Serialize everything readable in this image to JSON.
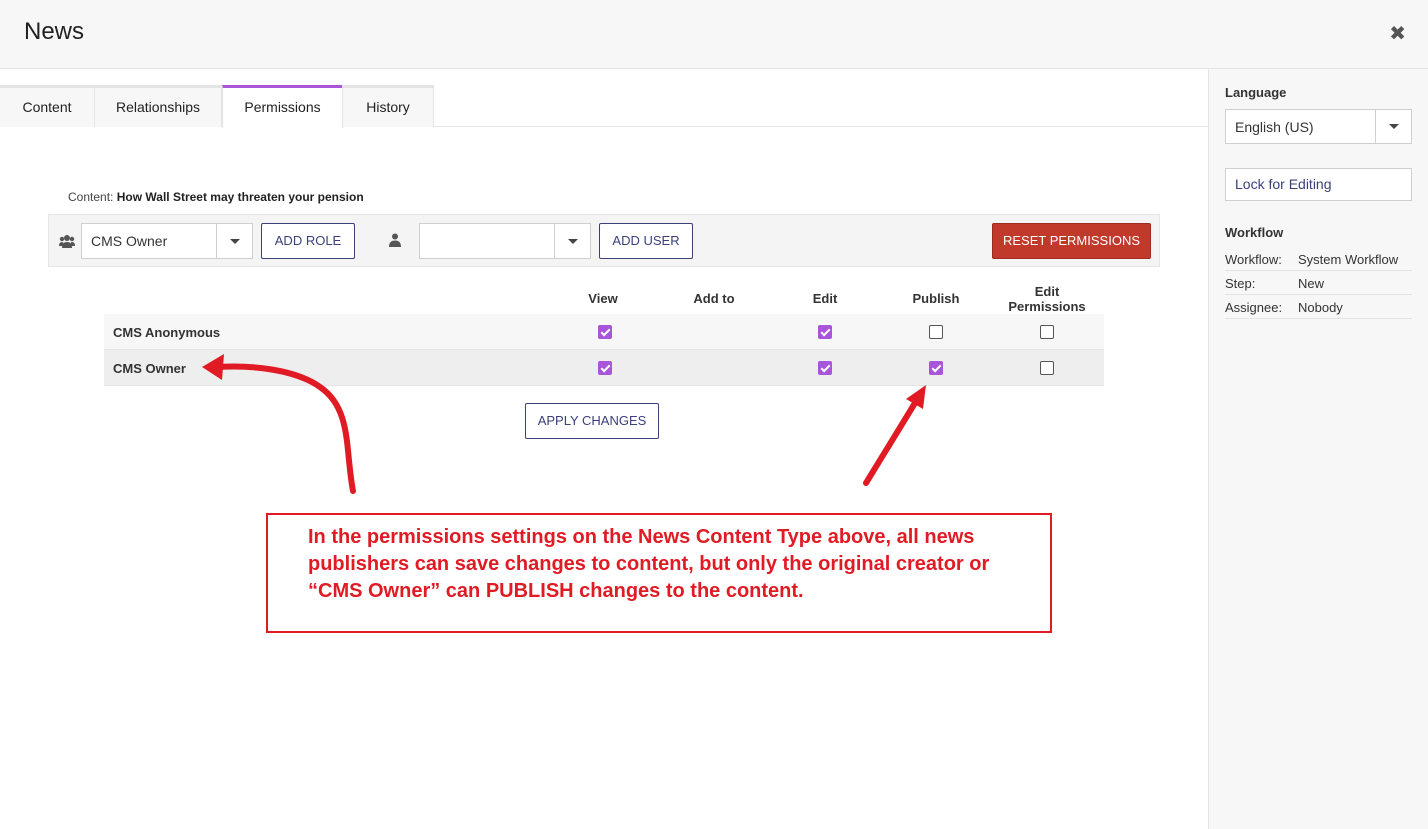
{
  "header": {
    "title": "News"
  },
  "tabs": [
    {
      "label": "Content",
      "active": false
    },
    {
      "label": "Relationships",
      "active": false
    },
    {
      "label": "Permissions",
      "active": true
    },
    {
      "label": "History",
      "active": false
    }
  ],
  "content": {
    "prefix": "Content:",
    "title": "How Wall Street may threaten your pension"
  },
  "toolbar": {
    "role_select_value": "CMS Owner",
    "add_role_label": "ADD ROLE",
    "user_select_value": "",
    "add_user_label": "ADD USER",
    "reset_label": "RESET PERMISSIONS"
  },
  "permissions": {
    "columns": [
      "View",
      "Add to",
      "Edit",
      "Publish",
      "Edit Permissions"
    ],
    "rows": [
      {
        "role": "CMS Anonymous",
        "view": true,
        "edit": true,
        "publish": false,
        "edit_permissions": false
      },
      {
        "role": "CMS Owner",
        "view": true,
        "edit": true,
        "publish": true,
        "edit_permissions": false
      }
    ]
  },
  "apply_label": "APPLY CHANGES",
  "callout": {
    "text": "In the permissions settings on the News Content Type above, all news publishers can save changes to content, but only the original creator or “CMS Owner” can PUBLISH changes to the content."
  },
  "sidebar": {
    "language_label": "Language",
    "language_value": "English (US)",
    "lock_label": "Lock for Editing",
    "workflow_label": "Workflow",
    "workflow": [
      {
        "key": "Workflow:",
        "value": "System Workflow"
      },
      {
        "key": "Step:",
        "value": "New"
      },
      {
        "key": "Assignee:",
        "value": "Nobody"
      }
    ]
  },
  "colors": {
    "accent": "#a855d9",
    "danger": "#c0392b",
    "annotation": "#e01b24",
    "button_text": "#3b3f7a"
  }
}
